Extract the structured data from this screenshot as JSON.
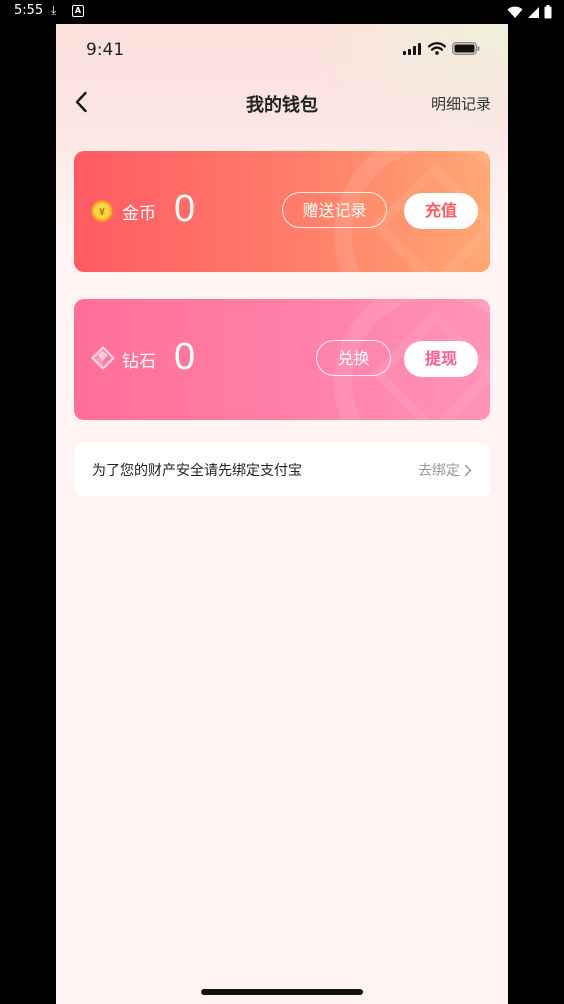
{
  "android_status": {
    "time": "5:55",
    "download_icon": "download-icon",
    "a_icon": "A"
  },
  "ios_status": {
    "time": "9:41"
  },
  "header": {
    "title": "我的钱包",
    "right_link": "明细记录"
  },
  "coin_card": {
    "label": "金币",
    "value": "0",
    "secondary_button": "赠送记录",
    "primary_button": "充值",
    "accent": "#ff5b63",
    "icon_symbol": "¥"
  },
  "diamond_card": {
    "label": "钻石",
    "value": "0",
    "secondary_button": "兑换",
    "primary_button": "提现",
    "accent": "#ff6f98"
  },
  "notice": {
    "text": "为了您的财产安全请先绑定支付宝",
    "action": "去绑定"
  },
  "colors": {
    "background": "#fff4f3",
    "coin_button_text": "#ff5a5f",
    "diamond_button_text": "#ff5a8f"
  }
}
